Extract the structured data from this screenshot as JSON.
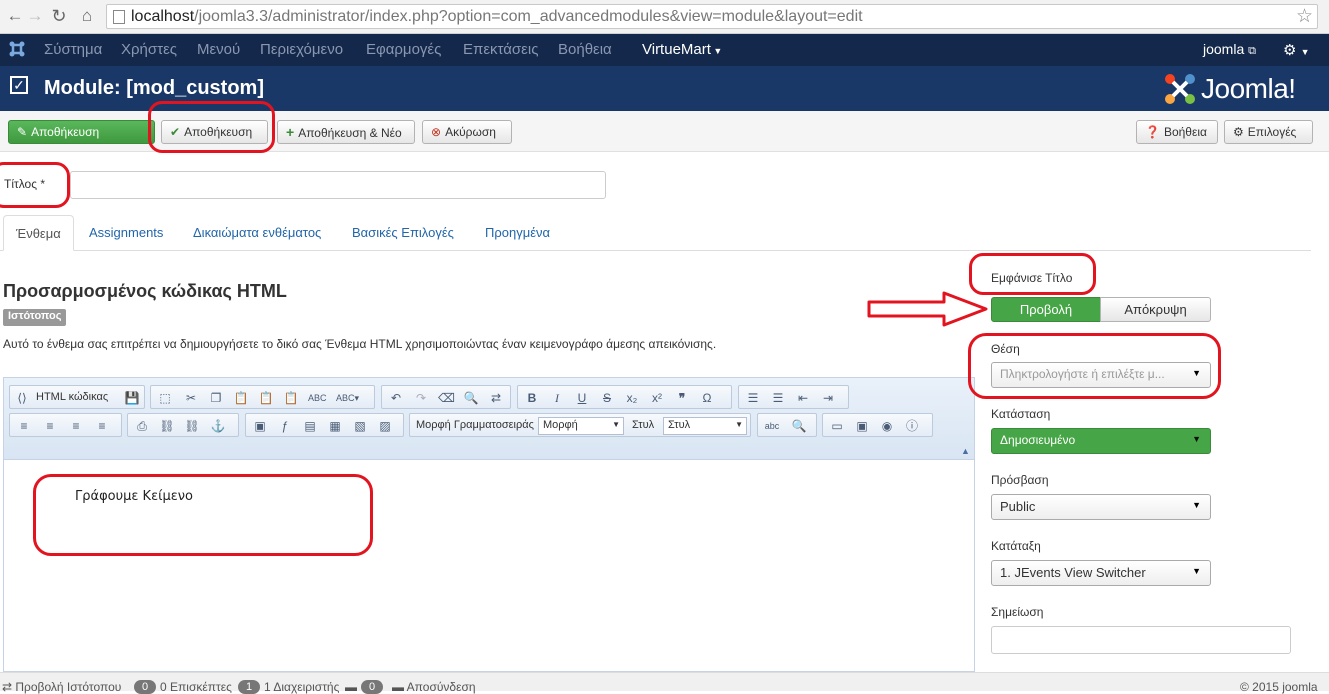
{
  "browser": {
    "url_host": "localhost",
    "url_rest": "/joomla3.3/administrator/index.php?option=com_advancedmodules&view=module&layout=edit"
  },
  "topnav": {
    "items": [
      "Σύστημα",
      "Χρήστες",
      "Μενού",
      "Περιεχόμενο",
      "Εφαρμογές",
      "Επεκτάσεις",
      "Βοήθεια"
    ],
    "virtuemart": "VirtueMart",
    "user": "joomla"
  },
  "header": {
    "title": "Module: [mod_custom]",
    "brand": "Joomla!"
  },
  "toolbar": {
    "save": "Αποθήκευση",
    "save_close": "Αποθήκευση",
    "save_new": "Αποθήκευση & Νέο",
    "cancel": "Ακύρωση",
    "help": "Βοήθεια",
    "options": "Επιλογές"
  },
  "title_field": {
    "label": "Τίτλος *",
    "value": ""
  },
  "tabs": [
    "Ένθεμα",
    "Assignments",
    "Δικαιώματα ενθέματος",
    "Βασικές Επιλογές",
    "Προηγμένα"
  ],
  "module": {
    "heading": "Προσαρμοσμένος κώδικας HTML",
    "badge": "Ιστότοπος",
    "description": "Αυτό το ένθεμα σας επιτρέπει να δημιουργήσετε το δικό σας Ένθεμα HTML χρησιμοποιώντας έναν κειμενογράφο άμεσης απεικόνισης."
  },
  "editor": {
    "html_button": "HTML κώδικας",
    "font_family_label": "Μορφή Γραμματοσειράς",
    "format_label": "Μορφή",
    "style_label": "Στυλ",
    "style_value": "Στυλ",
    "content": "Γράφουμε Κείμενο"
  },
  "sidebar": {
    "show_title_label": "Εμφάνισε Τίτλο",
    "show": "Προβολή",
    "hide": "Απόκρυψη",
    "position_label": "Θέση",
    "position_placeholder": "Πληκτρολογήστε ή επιλέξτε μ...",
    "status_label": "Κατάσταση",
    "status_value": "Δημοσιευμένο",
    "access_label": "Πρόσβαση",
    "access_value": "Public",
    "ordering_label": "Κατάταξη",
    "ordering_value": "1. JEvents View Switcher",
    "note_label": "Σημείωση",
    "note_value": ""
  },
  "footer": {
    "view_site": "Προβολή Ιστότοπου",
    "visitors_count": "0",
    "visitors_label": "Επισκέπτες",
    "admins_count": "1",
    "admins_label": "Διαχειριστής",
    "messages_count": "0",
    "logout": "Αποσύνδεση",
    "copyright": "© 2015 joomla"
  },
  "colors": {
    "topnav_bg": "#14284b",
    "header_bg": "#1a3867",
    "accent_green": "#46a546",
    "annotation_red": "#e2141f"
  }
}
